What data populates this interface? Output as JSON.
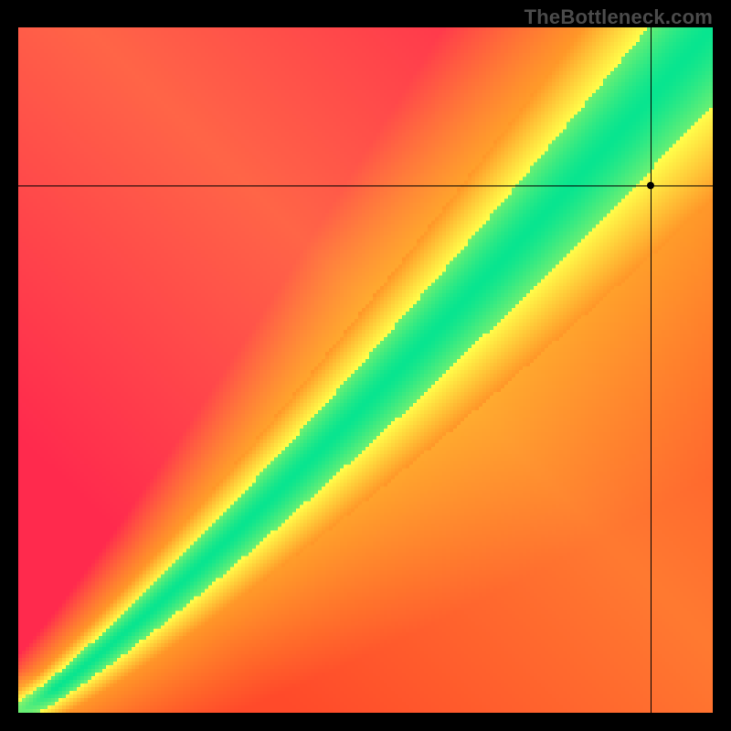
{
  "watermark": "TheBottleneck.com",
  "chart_data": {
    "type": "heatmap",
    "title": "",
    "xlabel": "",
    "ylabel": "",
    "xlim": [
      0,
      100
    ],
    "ylim": [
      0,
      100
    ],
    "grid": false,
    "legend": false,
    "description": "Bottleneck-compatibility heatmap. A narrow diagonal green band (optimal pairing) runs from the lower-left origin toward the upper-right, surrounded by yellow transition zones and red far from the diagonal. Color encodes compatibility: green≈optimal, yellow≈marginal, red≈poor.",
    "band": {
      "lower_slope": 0.82,
      "upper_slope": 1.05,
      "curvature": 1.15
    },
    "colors": {
      "optimal": "#08e58f",
      "warning": "#ffff4a",
      "poor_cold": "#ff2a4d",
      "poor_hot": "#ff4a2a"
    },
    "crosshair": {
      "x": 91,
      "y": 77
    },
    "marker": {
      "x": 91,
      "y": 77
    }
  },
  "canvas": {
    "width": 190,
    "height": 188
  }
}
